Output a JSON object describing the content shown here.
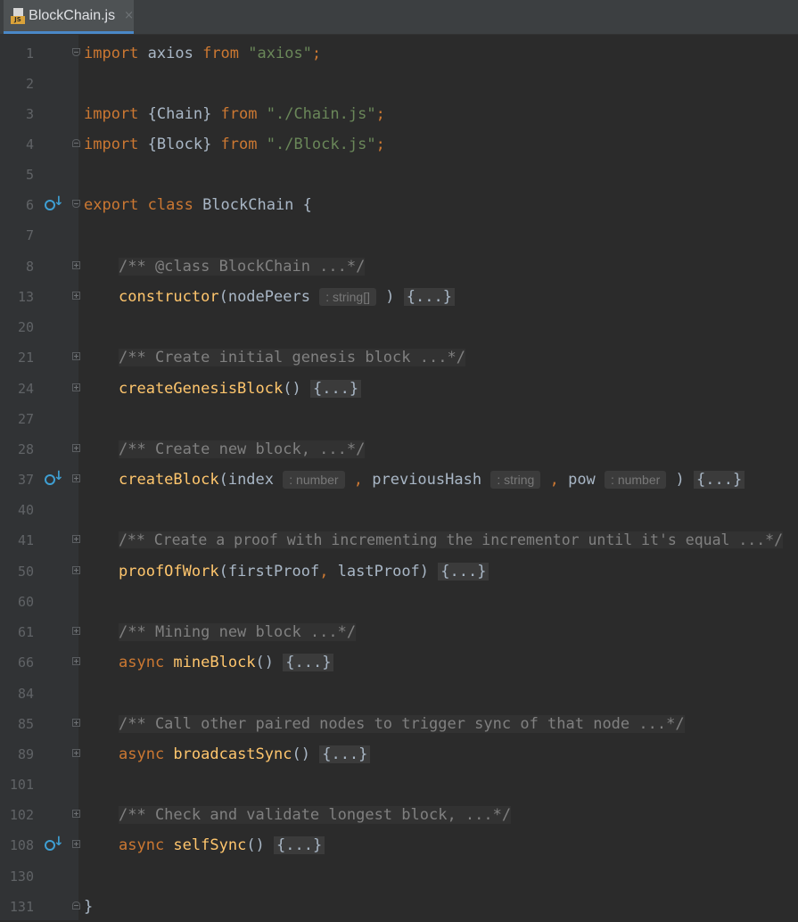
{
  "tab": {
    "filename": "BlockChain.js",
    "icon_label": "JS",
    "close": "×"
  },
  "lines": {
    "l1": {
      "num": "1",
      "kw": "import",
      "id": " axios ",
      "kw2": "from",
      "str": " \"axios\"",
      "semi": ";"
    },
    "l2": {
      "num": "2"
    },
    "l3": {
      "num": "3",
      "kw": "import",
      "id": " {Chain} ",
      "kw2": "from",
      "str": " \"./Chain.js\"",
      "semi": ";"
    },
    "l4": {
      "num": "4",
      "kw": "import",
      "id": " {Block} ",
      "kw2": "from",
      "str": " \"./Block.js\"",
      "semi": ";"
    },
    "l5": {
      "num": "5"
    },
    "l6": {
      "num": "6",
      "kw": "export class",
      "id": " BlockChain {"
    },
    "l7": {
      "num": "7"
    },
    "l8": {
      "num": "8",
      "comment": "/** @class BlockChain ...*/"
    },
    "l13": {
      "num": "13",
      "fn": "constructor",
      "p1": "(nodePeers",
      "hint1": ": string[]",
      "p2": ")",
      "body": "{...}"
    },
    "l20": {
      "num": "20"
    },
    "l21": {
      "num": "21",
      "comment": "/** Create initial genesis block ...*/"
    },
    "l24": {
      "num": "24",
      "fn": "createGenesisBlock",
      "p1": "()",
      "body": "{...}"
    },
    "l27": {
      "num": "27"
    },
    "l28": {
      "num": "28",
      "comment": "/** Create new block, ...*/"
    },
    "l37": {
      "num": "37",
      "fn": "createBlock",
      "p1": "(index",
      "hint1": ": number",
      "c1": ",",
      "p2": " previousHash",
      "hint2": ": string",
      "c2": ",",
      "p3": " pow",
      "hint3": ": number",
      "p4": ")",
      "body": "{...}"
    },
    "l40": {
      "num": "40"
    },
    "l41": {
      "num": "41",
      "comment": "/** Create a proof with incrementing the incrementor until it's equal ...*/"
    },
    "l50": {
      "num": "50",
      "fn": "proofOfWork",
      "p1": "(firstProof",
      "c1": ",",
      "p2": " lastProof)",
      "body": "{...}"
    },
    "l60": {
      "num": "60"
    },
    "l61": {
      "num": "61",
      "comment": "/** Mining new block ...*/"
    },
    "l66": {
      "num": "66",
      "kw": "async",
      "fn": " mineBlock",
      "p1": "()",
      "body": "{...}"
    },
    "l84": {
      "num": "84"
    },
    "l85": {
      "num": "85",
      "comment": "/** Call other paired nodes to trigger sync of that node ...*/"
    },
    "l89": {
      "num": "89",
      "kw": "async",
      "fn": " broadcastSync",
      "p1": "()",
      "body": "{...}"
    },
    "l101": {
      "num": "101"
    },
    "l102": {
      "num": "102",
      "comment": "/** Check and validate longest block, ...*/"
    },
    "l108": {
      "num": "108",
      "kw": "async",
      "fn": " selfSync",
      "p1": "()",
      "body": "{...}"
    },
    "l130": {
      "num": "130"
    },
    "l131": {
      "num": "131",
      "brace": "}"
    }
  },
  "colors": {
    "background": "#2b2b2b",
    "keyword": "#cc7832",
    "string": "#6a8759",
    "function": "#ffc66d",
    "comment": "#808080",
    "identifier": "#a9b7c6",
    "gutter_icon": "#3e9fd3"
  },
  "icons": [
    "js-file-icon",
    "close-icon",
    "override-method-icon",
    "fold-icon"
  ]
}
